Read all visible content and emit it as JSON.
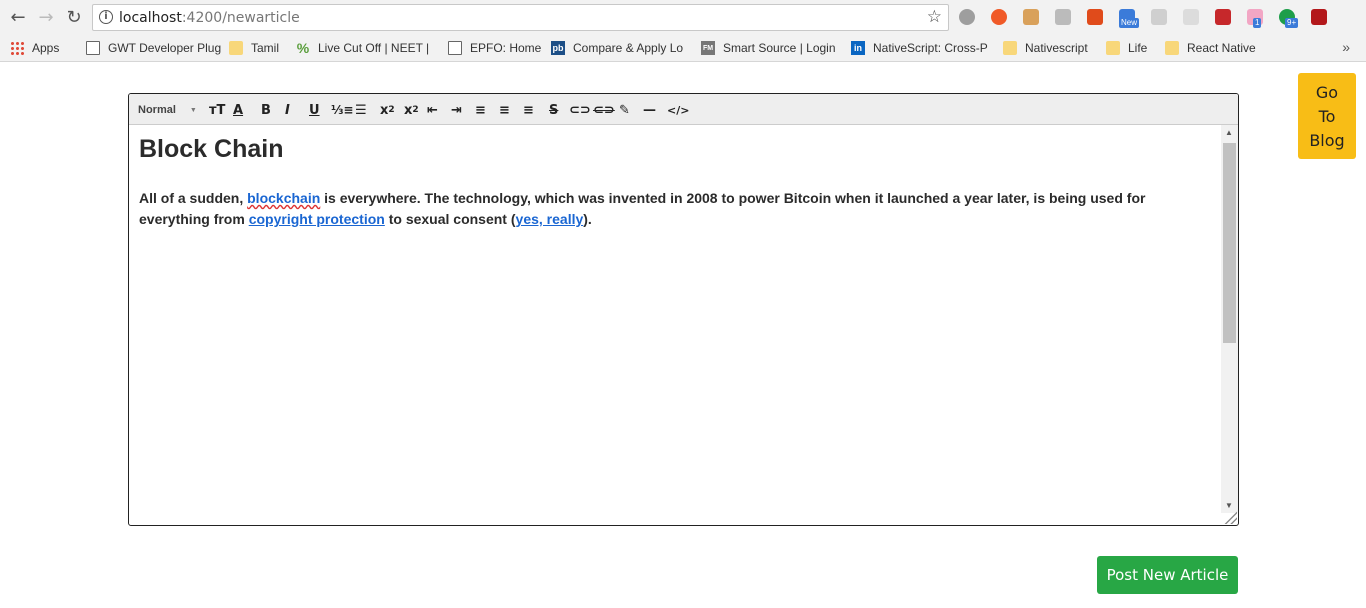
{
  "browser": {
    "url_host": "localhost",
    "url_path": ":4200/newarticle",
    "extensions": [
      {
        "name": "ext-gray-icon",
        "color": "#9e9e9e"
      },
      {
        "name": "ext-orange-icon",
        "color": "#f05a28"
      },
      {
        "name": "ext-cookie-icon",
        "color": "#d9a15b"
      },
      {
        "name": "ext-tag-icon",
        "color": "#bbbbbb"
      },
      {
        "name": "ext-office-icon",
        "color": "#e04b1b"
      },
      {
        "name": "ext-new-icon",
        "color": "#3b7bd9",
        "badge": "New"
      },
      {
        "name": "ext-doc-icon",
        "color": "#cfcfcf"
      },
      {
        "name": "ext-puzzle-icon",
        "color": "#dcdcdc"
      },
      {
        "name": "ext-red-icon",
        "color": "#c6282b"
      },
      {
        "name": "ext-pink-icon",
        "color": "#f2a6c4",
        "badge": "1"
      },
      {
        "name": "ext-green-icon",
        "color": "#1e9e4a",
        "badge": "9+"
      },
      {
        "name": "ext-pdf-icon",
        "color": "#b3181b"
      }
    ]
  },
  "bookmarks": [
    {
      "label": "Apps",
      "icon": "apps"
    },
    {
      "label": "GWT Developer Plug",
      "icon": "page"
    },
    {
      "label": "Tamil",
      "icon": "folder"
    },
    {
      "label": "Live Cut Off | NEET |",
      "icon": "pct"
    },
    {
      "label": "EPFO: Home",
      "icon": "page"
    },
    {
      "label": "Compare & Apply Lo",
      "icon": "pb"
    },
    {
      "label": "Smart Source | Login",
      "icon": "fm"
    },
    {
      "label": "NativeScript: Cross-P",
      "icon": "li"
    },
    {
      "label": "Nativescript",
      "icon": "folder"
    },
    {
      "label": "Life",
      "icon": "folder"
    },
    {
      "label": "React Native",
      "icon": "folder"
    }
  ],
  "bookmarks_more": "»",
  "editor": {
    "format_select": "Normal",
    "heading": "Block Chain",
    "para_1": "All of a sudden, ",
    "link_1": "blockchain",
    "para_2": " is everywhere. The technology, which was invented in 2008 to power Bitcoin when it launched a year later, is being used for everything from ",
    "link_2": "copyright protection",
    "para_3": " to sexual consent (",
    "link_3": "yes, really",
    "para_4": ")."
  },
  "go_blog": {
    "line1": "Go",
    "line2": "To",
    "line3": "Blog"
  },
  "post_button": "Post New Article"
}
